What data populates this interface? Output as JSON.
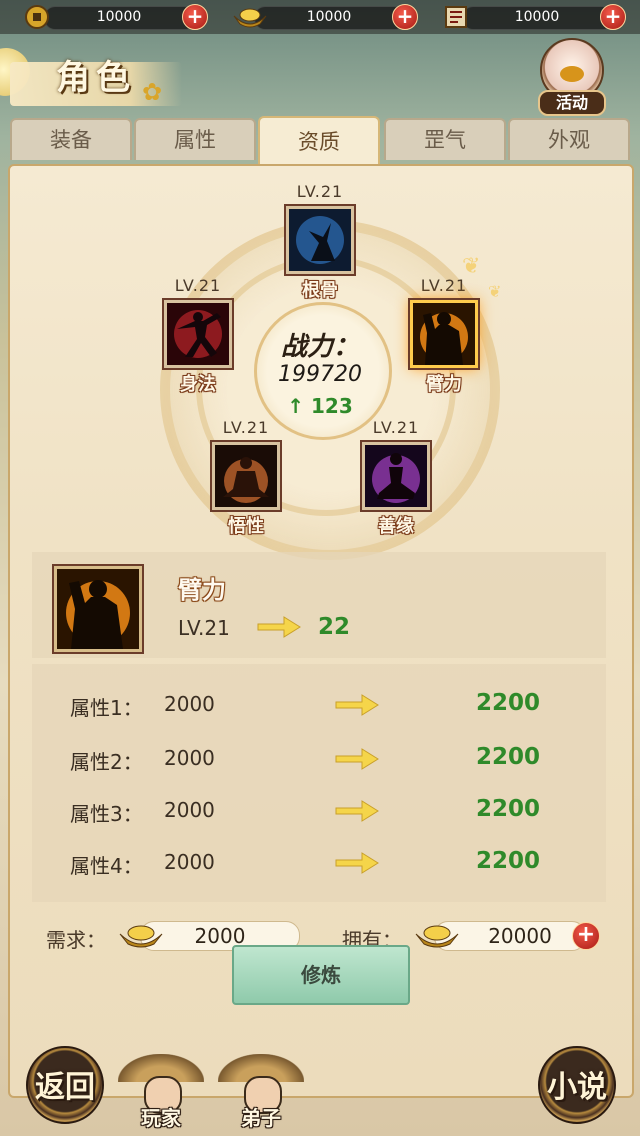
{
  "currency": [
    {
      "icon": "copper-coin-icon",
      "value": "10000"
    },
    {
      "icon": "gold-ingot-icon",
      "value": "10000"
    },
    {
      "icon": "scroll-icon",
      "value": "10000"
    }
  ],
  "header": {
    "title": "角色",
    "activity_label": "活动"
  },
  "tabs": [
    "装备",
    "属性",
    "资质",
    "罡气",
    "外观"
  ],
  "active_tab": "资质",
  "combat": {
    "label": "战力：",
    "value": "199720",
    "gain": "123"
  },
  "aptitudes": [
    {
      "key": "gengu",
      "name": "根骨",
      "level": "LV.21",
      "color": "#2f6fb8"
    },
    {
      "key": "shenfa",
      "name": "身法",
      "level": "LV.21",
      "color": "#b8242a"
    },
    {
      "key": "bili",
      "name": "臂力",
      "level": "LV.21",
      "color": "#f08a16",
      "selected": true
    },
    {
      "key": "wuxing",
      "name": "悟性",
      "level": "LV.21",
      "color": "#c96a30"
    },
    {
      "key": "shanyuan",
      "name": "善缘",
      "level": "LV.21",
      "color": "#9b3fb8"
    }
  ],
  "selected": {
    "name": "臂力",
    "level": "LV.21",
    "next_level": "22"
  },
  "attributes": [
    {
      "label": "属性1：",
      "current": "2000",
      "next": "2200"
    },
    {
      "label": "属性2：",
      "current": "2000",
      "next": "2200"
    },
    {
      "label": "属性3：",
      "current": "2000",
      "next": "2200"
    },
    {
      "label": "属性4：",
      "current": "2000",
      "next": "2200"
    }
  ],
  "cost": {
    "need_label": "需求：",
    "need_value": "2000",
    "have_label": "拥有：",
    "have_value": "20000"
  },
  "train_button": "修炼",
  "bottom_nav": {
    "back": "返回",
    "player": "玩家",
    "disciple": "弟子",
    "novel": "小说"
  },
  "colors": {
    "accent_green": "#2f8a2a",
    "frame_gold": "#c9a76b",
    "plus_red": "#c8281c"
  }
}
